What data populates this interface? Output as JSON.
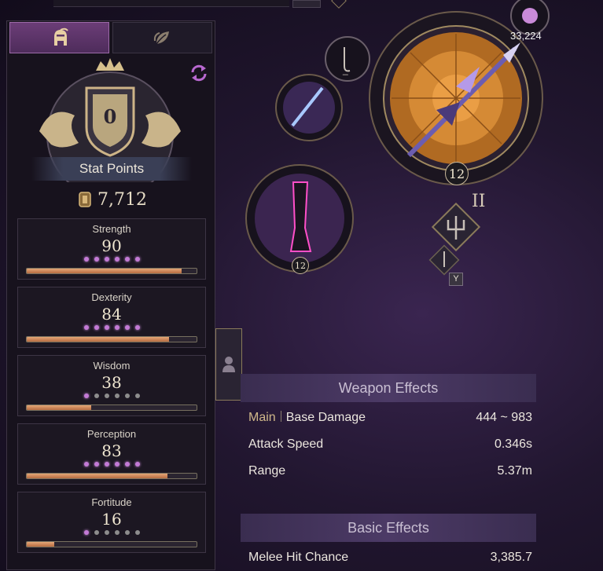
{
  "tabs": {
    "character_icon": "helmet-icon",
    "skill_icon": "leaf-icon"
  },
  "stat_points": {
    "label": "Stat Points",
    "value": "0"
  },
  "gold": {
    "value": "7,712"
  },
  "stats": [
    {
      "name": "Strength",
      "value": "90",
      "dots_on": 6,
      "fill": 0.91
    },
    {
      "name": "Dexterity",
      "value": "84",
      "dots_on": 6,
      "fill": 0.84
    },
    {
      "name": "Wisdom",
      "value": "38",
      "dots_on": 1,
      "fill": 0.38
    },
    {
      "name": "Perception",
      "value": "83",
      "dots_on": 6,
      "fill": 0.83
    },
    {
      "name": "Fortitude",
      "value": "16",
      "dots_on": 1,
      "fill": 0.16
    }
  ],
  "equipment": {
    "main_level": "12",
    "secondary_level": "12",
    "orb_count": "33,224",
    "roman": "II",
    "hotkey": "Y",
    "slot_hook_label": "_"
  },
  "weapon_effects": {
    "title": "Weapon Effects",
    "main_tag": "Main",
    "rows": [
      {
        "label": "Base Damage",
        "value": "444 ~ 983"
      },
      {
        "label": "Attack Speed",
        "value": "0.346s"
      },
      {
        "label": "Range",
        "value": "5.37m"
      }
    ]
  },
  "basic_effects": {
    "title": "Basic Effects",
    "rows": [
      {
        "label": "Melee Hit Chance",
        "value": "3,385.7"
      }
    ]
  },
  "colors": {
    "accent": "#c37ad6",
    "gold": "#c8b79a",
    "bar": "#d38d5c"
  }
}
